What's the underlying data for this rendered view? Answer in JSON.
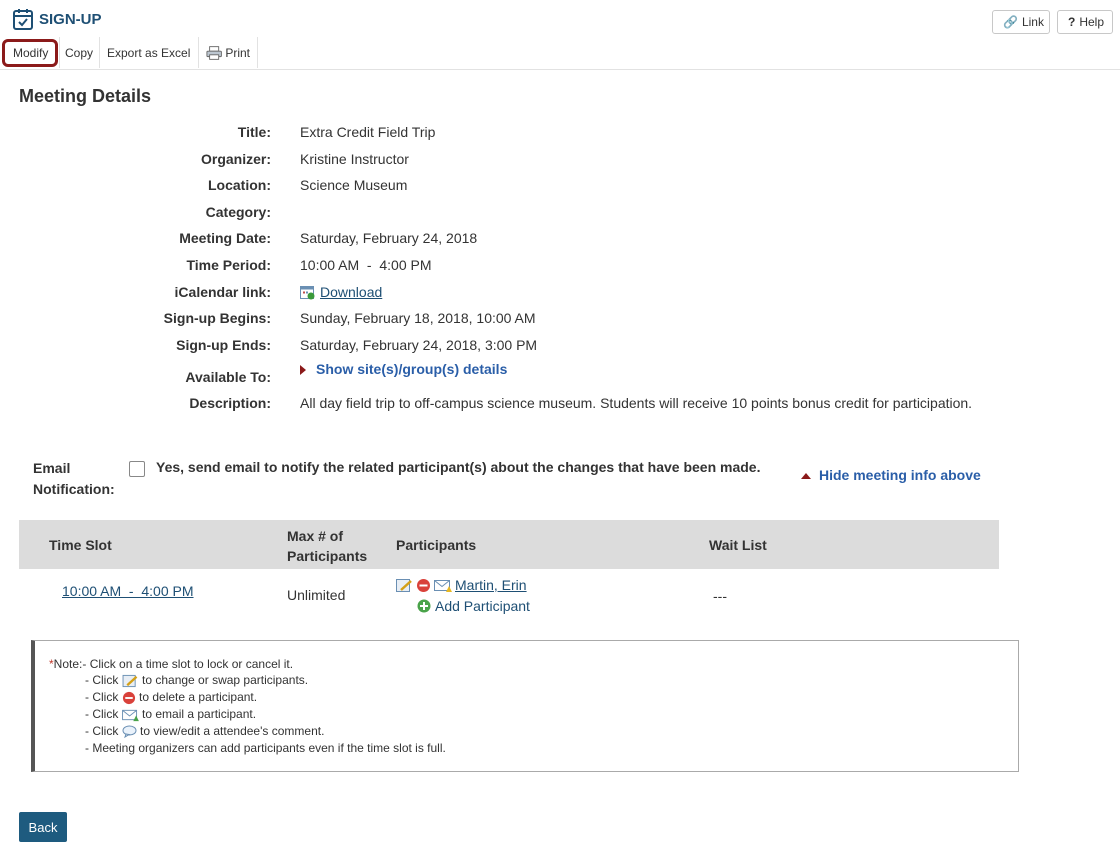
{
  "app": {
    "title": "SIGN-UP"
  },
  "top_buttons": {
    "link": "Link",
    "help": "Help"
  },
  "toolbar": {
    "modify": "Modify",
    "copy": "Copy",
    "export": "Export as Excel",
    "print": "Print"
  },
  "section_title": "Meeting Details",
  "details": {
    "title_label": "Title:",
    "title_value": "Extra Credit Field Trip",
    "organizer_label": "Organizer:",
    "organizer_value": "Kristine Instructor",
    "location_label": "Location:",
    "location_value": "Science Museum",
    "category_label": "Category:",
    "category_value": "",
    "date_label": "Meeting Date:",
    "date_value": "Saturday, February 24, 2018",
    "period_label": "Time Period:",
    "period_value": "10:00 AM  -  4:00 PM",
    "ical_label": "iCalendar link:",
    "ical_value": "Download",
    "begins_label": "Sign-up Begins:",
    "begins_value": "Sunday, February 18, 2018, 10:00 AM",
    "ends_label": "Sign-up Ends:",
    "ends_value": "Saturday, February 24, 2018, 3:00 PM",
    "available_label": "Available To:",
    "available_value": "Show site(s)/group(s) details",
    "description_label": "Description:",
    "description_value": "All day field trip to off-campus science museum. Students will receive 10 points bonus credit for participation."
  },
  "email": {
    "label_line1": "Email",
    "label_line2": "Notification:",
    "checkbox_text": "Yes, send email to notify the related participant(s) about the changes that have been made.",
    "checked": false
  },
  "hide_info": "Hide meeting info above",
  "table": {
    "headers": {
      "time_slot": "Time Slot",
      "max_line1": "Max # of",
      "max_line2": "Participants",
      "participants": "Participants",
      "wait_list": "Wait List"
    },
    "rows": [
      {
        "time_slot": "10:00 AM  -  4:00 PM",
        "max": "Unlimited",
        "participant": "Martin, Erin",
        "add": "Add Participant",
        "wait_list": "---"
      }
    ]
  },
  "note": {
    "star": "*",
    "prefix": "Note:",
    "line1": "- Click on a time slot to lock or cancel it.",
    "line2_a": "- Click",
    "line2_b": "to change or swap participants.",
    "line3_a": "- Click",
    "line3_b": "to delete a participant.",
    "line4_a": "- Click",
    "line4_b": "to email a participant.",
    "line5_a": "- Click",
    "line5_b": "to view/edit a attendee's comment.",
    "line6": "- Meeting organizers can add participants even if the time slot is full."
  },
  "back_button": "Back"
}
